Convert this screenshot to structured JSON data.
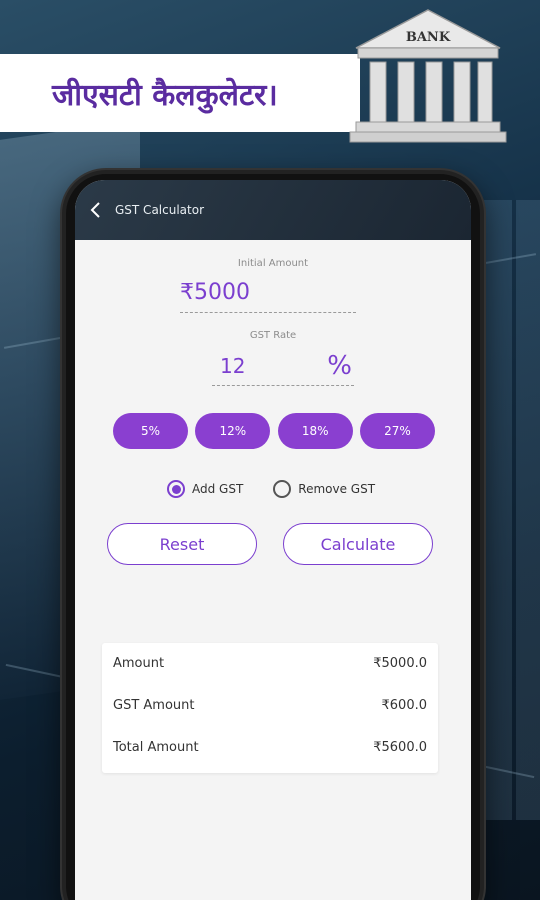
{
  "banner": {
    "title": "जीएसटी कैलकुलेटर।",
    "logo_text": "BANK"
  },
  "colors": {
    "accent": "#7b3fcf",
    "chip": "#8a3fd0",
    "banner_text": "#5a2ca0"
  },
  "app": {
    "title": "GST Calculator",
    "back_icon": "chevron-left-icon"
  },
  "inputs": {
    "initial_amount_label": "Initial Amount",
    "initial_amount_value": "₹5000",
    "gst_rate_label": "GST Rate",
    "gst_rate_value": "12",
    "gst_rate_suffix": "%"
  },
  "rate_chips": [
    "5%",
    "12%",
    "18%",
    "27%"
  ],
  "mode": {
    "add_label": "Add GST",
    "remove_label": "Remove GST",
    "selected": "add"
  },
  "buttons": {
    "reset": "Reset",
    "calculate": "Calculate"
  },
  "results": [
    {
      "label": "Amount",
      "value": "₹5000.0"
    },
    {
      "label": "GST Amount",
      "value": "₹600.0"
    },
    {
      "label": "Total Amount",
      "value": "₹5600.0"
    }
  ]
}
